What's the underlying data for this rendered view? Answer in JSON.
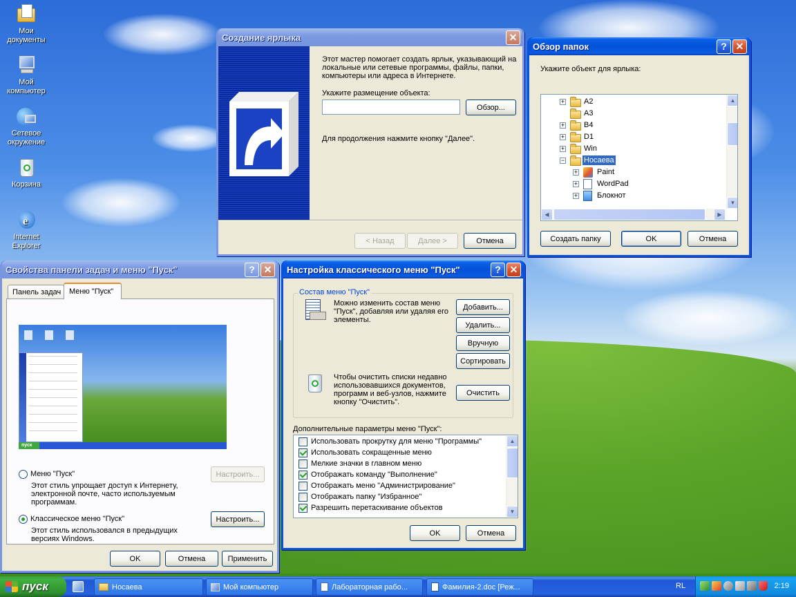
{
  "desktop": {
    "icons": [
      {
        "label": "Мои документы",
        "icon": "my-documents-icon"
      },
      {
        "label": "Мой компьютер",
        "icon": "my-computer-icon"
      },
      {
        "label": "Сетевое окружение",
        "icon": "network-icon"
      },
      {
        "label": "Корзина",
        "icon": "recycle-bin-icon"
      },
      {
        "label": "Internet Explorer",
        "icon": "internet-explorer-icon"
      }
    ]
  },
  "shortcut_wizard": {
    "title": "Создание ярлыка",
    "intro": "Этот мастер помогает создать ярлык, указывающий на локальные или сетевые программы, файлы, папки, компьютеры или адреса в Интернете.",
    "location_label": "Укажите размещение объекта:",
    "location_value": "",
    "browse_button": "Обзор...",
    "continue_hint": "Для продолжения нажмите кнопку \"Далее\".",
    "back_button": "< Назад",
    "next_button": "Далее >",
    "cancel_button": "Отмена"
  },
  "browse_folders": {
    "title": "Обзор папок",
    "prompt": "Укажите объект для ярлыка:",
    "tree": [
      {
        "label": "A2",
        "level": 0,
        "expander": "+"
      },
      {
        "label": "A3",
        "level": 0,
        "expander": ""
      },
      {
        "label": "B4",
        "level": 0,
        "expander": "+"
      },
      {
        "label": "D1",
        "level": 0,
        "expander": "+"
      },
      {
        "label": "Win",
        "level": 0,
        "expander": "+"
      },
      {
        "label": "Носаева",
        "level": 0,
        "expander": "-",
        "selected": true
      },
      {
        "label": "Paint",
        "level": 1,
        "expander": "+"
      },
      {
        "label": "WordPad",
        "level": 1,
        "expander": "+"
      },
      {
        "label": "Блокнот",
        "level": 1,
        "expander": "+"
      }
    ],
    "new_folder_button": "Создать папку",
    "ok_button": "OK",
    "cancel_button": "Отмена"
  },
  "taskbar_props": {
    "title": "Свойства панели задач и меню \"Пуск\"",
    "tabs": [
      "Панель задач",
      "Меню \"Пуск\""
    ],
    "active_tab": 1,
    "option_start": {
      "label": "Меню \"Пуск\"",
      "desc": "Этот стиль упрощает доступ к Интернету, электронной почте, часто используемым программам.",
      "button": "Настроить..."
    },
    "option_classic": {
      "label": "Классическое меню \"Пуск\"",
      "desc": "Этот стиль использовался в предыдущих версиях Windows.",
      "button": "Настроить..."
    },
    "preview_start_label": "пуск",
    "ok_button": "OK",
    "cancel_button": "Отмена",
    "apply_button": "Применить"
  },
  "classic_menu": {
    "title": "Настройка классического меню \"Пуск\"",
    "group_label": "Состав меню \"Пуск\"",
    "compose_text": "Можно изменить состав меню \"Пуск\", добавляя или удаляя его элементы.",
    "add_button": "Добавить...",
    "remove_button": "Удалить...",
    "manual_button": "Вручную",
    "sort_button": "Сортировать",
    "clear_text": "Чтобы очистить списки недавно использовавшихся документов, программ и веб-узлов, нажмите кнопку \"Очистить\".",
    "clear_button": "Очистить",
    "advanced_label": "Дополнительные параметры меню \"Пуск\":",
    "options": [
      {
        "label": "Использовать прокрутку для меню \"Программы\"",
        "checked": false
      },
      {
        "label": "Использовать сокращенные меню",
        "checked": true
      },
      {
        "label": "Мелкие значки в главном меню",
        "checked": false
      },
      {
        "label": "Отображать команду \"Выполнение\"",
        "checked": true
      },
      {
        "label": "Отображать меню \"Администрирование\"",
        "checked": false
      },
      {
        "label": "Отображать папку \"Избранное\"",
        "checked": false
      },
      {
        "label": "Разрешить перетаскивание объектов",
        "checked": true
      }
    ],
    "ok_button": "OK",
    "cancel_button": "Отмена"
  },
  "taskbar": {
    "start_label": "пуск",
    "tasks": [
      "Носаева",
      "Мой компьютер",
      "Лабораторная рабо...",
      "Фамилия-2.doc [Реж..."
    ],
    "language": "RL",
    "clock": "2:19"
  }
}
